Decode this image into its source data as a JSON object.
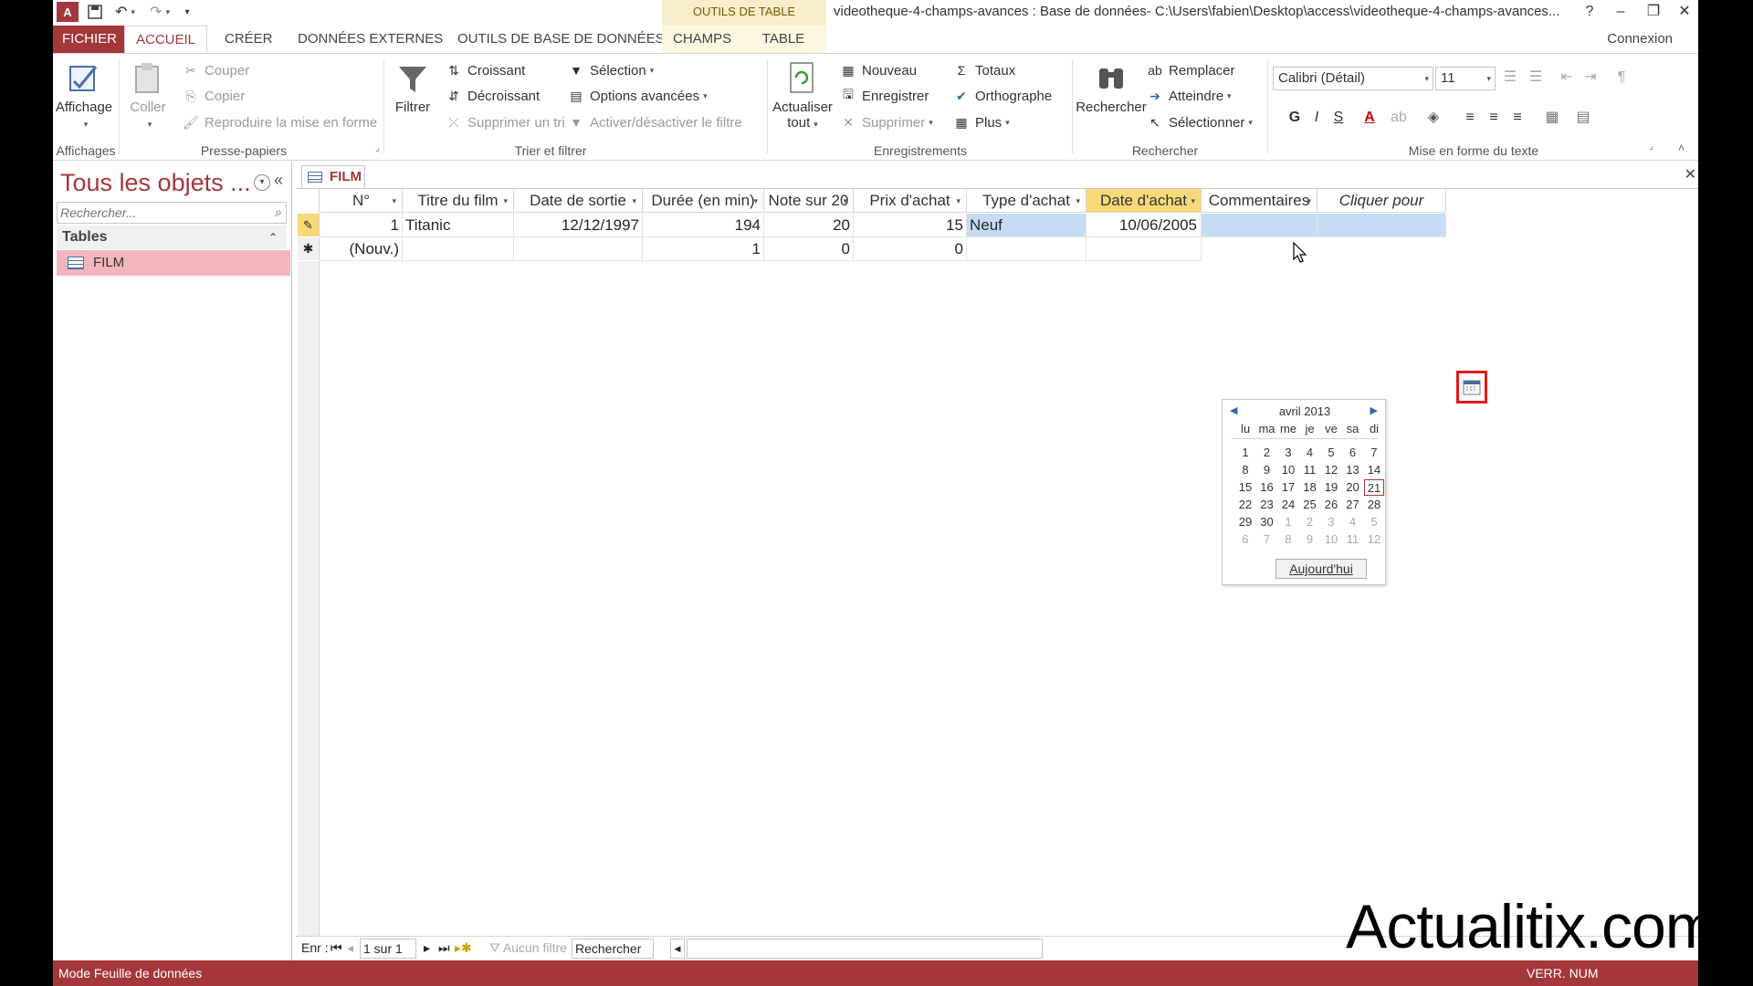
{
  "app": {
    "window_title": "videotheque-4-champs-avances : Base de données- C:\\Users\\fabien\\Desktop\\access\\videotheque-4-champs-avances...",
    "context_tab_group": "OUTILS DE TABLE",
    "help": "?",
    "connexion": "Connexion"
  },
  "tabs": [
    "FICHIER",
    "ACCUEIL",
    "CRÉER",
    "DONNÉES EXTERNES",
    "OUTILS DE BASE DE DONNÉES",
    "CHAMPS",
    "TABLE"
  ],
  "ribbon": {
    "affichages": {
      "affichage": "Affichage",
      "group": "Affichages"
    },
    "presse_papiers": {
      "coller": "Coller",
      "couper": "Couper",
      "copier": "Copier",
      "reproduire": "Reproduire la mise en forme",
      "group": "Presse-papiers"
    },
    "trier_filtrer": {
      "filtrer": "Filtrer",
      "croissant": "Croissant",
      "decroissant": "Décroissant",
      "supprimer_tri": "Supprimer un tri",
      "selection": "Sélection",
      "options_avancees": "Options avancées",
      "activer_filtre": "Activer/désactiver le filtre",
      "group": "Trier et filtrer"
    },
    "enregistrements": {
      "actualiser": "Actualiser",
      "actualiser2": "tout",
      "nouveau": "Nouveau",
      "enregistrer": "Enregistrer",
      "supprimer": "Supprimer",
      "totaux": "Totaux",
      "orthographe": "Orthographe",
      "plus": "Plus",
      "group": "Enregistrements"
    },
    "rechercher": {
      "rechercher": "Rechercher",
      "remplacer": "Remplacer",
      "atteindre": "Atteindre",
      "selectionner": "Sélectionner",
      "group": "Rechercher"
    },
    "mise_en_forme": {
      "font": "Calibri (Détail)",
      "size": "11",
      "bold": "G",
      "italic": "I",
      "underline": "S",
      "group": "Mise en forme du texte"
    }
  },
  "nav": {
    "title": "Tous les objets ...",
    "search_placeholder": "Rechercher...",
    "section": "Tables",
    "items": [
      "FILM"
    ]
  },
  "document": {
    "tab": "FILM",
    "columns": [
      "N°",
      "Titre du film",
      "Date de sortie",
      "Durée (en min)",
      "Note sur 20",
      "Prix d'achat",
      "Type d'achat",
      "Date d'achat",
      "Commentaires",
      "Cliquer pour ajouter"
    ],
    "rows": [
      [
        "1",
        "Titanic",
        "12/12/1997",
        "194",
        "20",
        "15",
        "Neuf",
        "10/06/2005",
        "",
        ""
      ],
      [
        "(Nouv.)",
        "",
        "",
        "1",
        "0",
        "0",
        "",
        "",
        "",
        ""
      ]
    ]
  },
  "calendar": {
    "month": "avril 2013",
    "dow": [
      "lu",
      "ma",
      "me",
      "je",
      "ve",
      "sa",
      "di"
    ],
    "weeks": [
      [
        "1",
        "2",
        "3",
        "4",
        "5",
        "6",
        "7"
      ],
      [
        "8",
        "9",
        "10",
        "11",
        "12",
        "13",
        "14"
      ],
      [
        "15",
        "16",
        "17",
        "18",
        "19",
        "20",
        "21"
      ],
      [
        "22",
        "23",
        "24",
        "25",
        "26",
        "27",
        "28"
      ],
      [
        "29",
        "30",
        "1",
        "2",
        "3",
        "4",
        "5"
      ],
      [
        "6",
        "7",
        "8",
        "9",
        "10",
        "11",
        "12"
      ]
    ],
    "today_label": "Aujourd'hui",
    "highlight": "21"
  },
  "recnav": {
    "label": "Enr :",
    "position": "1 sur 1",
    "filter": "Aucun filtre",
    "search": "Rechercher"
  },
  "status": {
    "left": "Mode Feuille de données",
    "right": "VERR. NUM"
  },
  "watermark": "Actualitix.com",
  "colors": {
    "accent": "#a4373a",
    "selected_nav": "#f4b6bd",
    "selected_cell": "#c6dcf5",
    "active_header": "#f7d979"
  }
}
